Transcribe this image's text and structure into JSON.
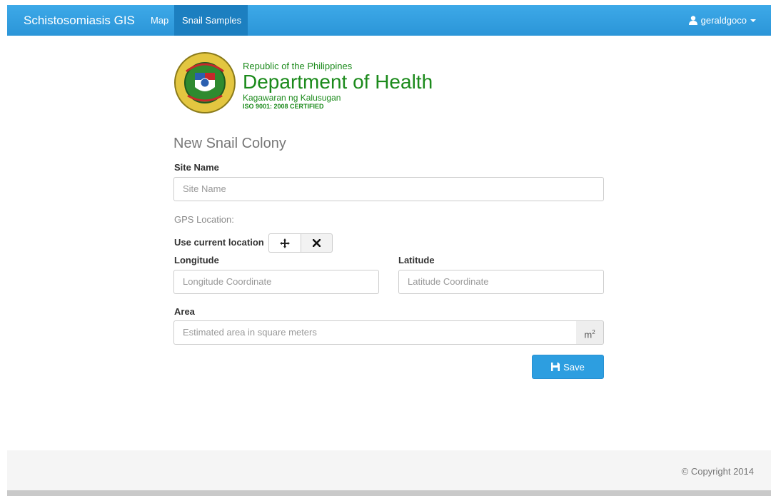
{
  "navbar": {
    "brand": "Schistosomiasis GIS",
    "links": [
      {
        "label": "Map",
        "active": false
      },
      {
        "label": "Snail Samples",
        "active": true
      }
    ],
    "user": {
      "name": "geraldgoco",
      "icon": "user-icon"
    }
  },
  "header": {
    "line1": "Republic of the Philippines",
    "line2": "Department of Health",
    "line3": "Kagawaran ng Kalusugan",
    "line4": "ISO 9001: 2008 CERTIFIED",
    "seal_text_top": "REPUBLIC OF THE PHILIPPINES",
    "seal_text_bottom": "DEPARTMENT OF HEALTH"
  },
  "form": {
    "title": "New Snail Colony",
    "site_name_label": "Site Name",
    "site_name_placeholder": "Site Name",
    "gps_label": "GPS Location:",
    "use_current_label": "Use current location",
    "locate_icon": "crosshair-icon",
    "clear_icon": "close-icon",
    "longitude_label": "Longitude",
    "longitude_placeholder": "Longitude Coordinate",
    "latitude_label": "Latitude",
    "latitude_placeholder": "Latitude Coordinate",
    "area_label": "Area",
    "area_placeholder": "Estimated area in square meters",
    "area_unit_base": "m",
    "area_unit_exp": "2",
    "save_label": "Save",
    "save_icon": "floppy-disk-icon"
  },
  "footer": {
    "copyright": "© Copyright 2014"
  },
  "colors": {
    "navbar": "#2b95d8",
    "active_nav": "#1c7fc0",
    "doh_green": "#1b8a1b",
    "save_button": "#2d9ee0"
  }
}
